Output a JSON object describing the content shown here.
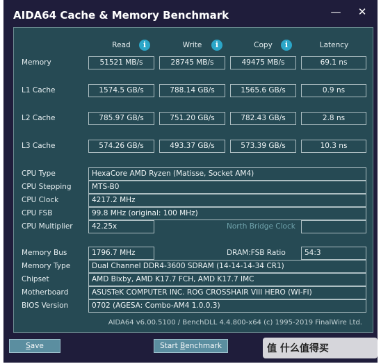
{
  "window": {
    "title": "AIDA64 Cache & Memory Benchmark",
    "minimize": "—",
    "close": "✕"
  },
  "columns": {
    "read": "Read",
    "write": "Write",
    "copy": "Copy",
    "latency": "Latency",
    "info": "i"
  },
  "rows": {
    "memory": {
      "label": "Memory",
      "read": "51521 MB/s",
      "write": "28745 MB/s",
      "copy": "49475 MB/s",
      "latency": "69.1 ns"
    },
    "l1": {
      "label": "L1 Cache",
      "read": "1574.5 GB/s",
      "write": "788.14 GB/s",
      "copy": "1565.6 GB/s",
      "latency": "0.9 ns"
    },
    "l2": {
      "label": "L2 Cache",
      "read": "785.97 GB/s",
      "write": "751.20 GB/s",
      "copy": "782.43 GB/s",
      "latency": "2.8 ns"
    },
    "l3": {
      "label": "L3 Cache",
      "read": "574.26 GB/s",
      "write": "493.37 GB/s",
      "copy": "573.39 GB/s",
      "latency": "10.3 ns"
    }
  },
  "cpu": {
    "type_label": "CPU Type",
    "type": "HexaCore AMD Ryzen  (Matisse, Socket AM4)",
    "stepping_label": "CPU Stepping",
    "stepping": "MTS-B0",
    "clock_label": "CPU Clock",
    "clock": "4217.2 MHz",
    "fsb_label": "CPU FSB",
    "fsb": "99.8 MHz  (original: 100 MHz)",
    "multiplier_label": "CPU Multiplier",
    "multiplier": "42.25x",
    "nb_clock_label": "North Bridge Clock"
  },
  "system": {
    "bus_label": "Memory Bus",
    "bus": "1796.7 MHz",
    "ratio_label": "DRAM:FSB Ratio",
    "ratio": "54:3",
    "memtype_label": "Memory Type",
    "memtype": "Dual Channel DDR4-3600 SDRAM  (14-14-14-34 CR1)",
    "chipset_label": "Chipset",
    "chipset": "AMD Bixby, AMD K17.7 FCH, AMD K17.7 IMC",
    "board_label": "Motherboard",
    "board": "ASUSTeK COMPUTER INC. ROG CROSSHAIR VIII HERO (WI-FI)",
    "bios_label": "BIOS Version",
    "bios": "0702  (AGESA: Combo-AM4 1.0.0.3)"
  },
  "footer": "AIDA64 v6.00.5100 / BenchDLL 4.4.800-x64  (c) 1995-2019 FinalWire Ltd.",
  "buttons": {
    "save_first": "S",
    "save_rest": "ave",
    "bench_start": "Start ",
    "bench_u": "B",
    "bench_rest": "enchmark"
  },
  "overlay": {
    "logo": "值 什么值得买"
  },
  "colors": {
    "title_bar": "#1f1d3b",
    "panel": "#264a54",
    "info": "#2ba6c8",
    "button": "#5b8ea0"
  }
}
